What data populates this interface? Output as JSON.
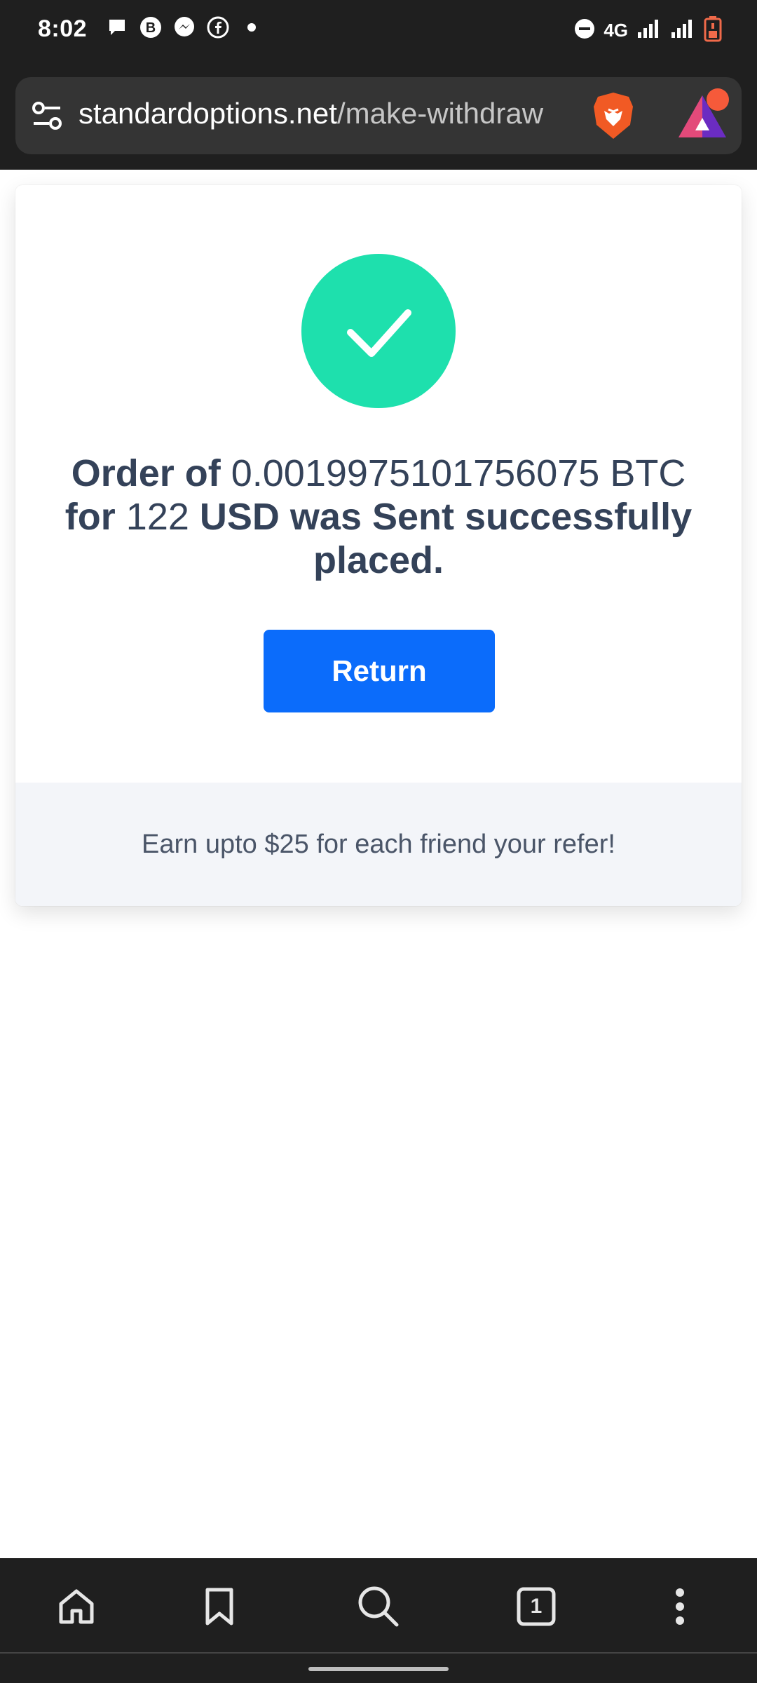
{
  "status_bar": {
    "time": "8:02",
    "network": "4G",
    "notification_icons": [
      "chat-bubble-icon",
      "bitcoin-b-icon",
      "messenger-icon",
      "facebook-icon",
      "dot-icon"
    ],
    "system_icons": [
      "do-not-disturb-icon",
      "signal-icon",
      "signal-icon",
      "battery-low-icon"
    ]
  },
  "browser": {
    "url_domain": "standardoptions.net",
    "url_path": "/make-withdraw",
    "icons": [
      "site-settings-icon",
      "brave-shields-icon",
      "brave-rewards-icon"
    ]
  },
  "order": {
    "prefix": "Order of",
    "btc_amount": "0.0019975101756075",
    "btc_unit": "BTC",
    "for_label": "for",
    "usd_amount": "122",
    "status_text": "USD was Sent successfully placed.",
    "return_label": "Return",
    "referral_text": "Earn upto $25 for each friend your refer!",
    "success_color": "#1ee0ad",
    "button_color": "#0b6cfb"
  },
  "bottom_nav": {
    "items": [
      "home-icon",
      "bookmark-icon",
      "search-icon",
      "tabs-icon",
      "more-icon"
    ],
    "tab_count": "1"
  }
}
